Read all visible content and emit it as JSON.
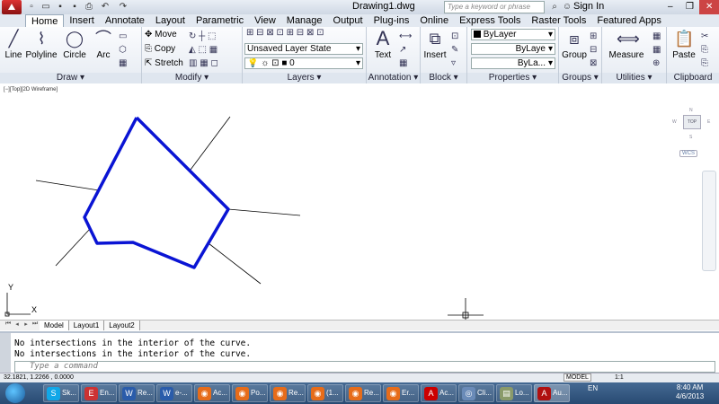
{
  "titlebar": {
    "doc_title": "Drawing1.dwg",
    "search_placeholder": "Type a keyword or phrase",
    "signin": "Sign In"
  },
  "tabs": [
    "Home",
    "Insert",
    "Annotate",
    "Layout",
    "Parametric",
    "View",
    "Manage",
    "Output",
    "Plug-ins",
    "Online",
    "Express Tools",
    "Raster Tools",
    "Featured Apps"
  ],
  "ribbon": {
    "draw": {
      "label": "Draw",
      "line": "Line",
      "polyline": "Polyline",
      "circle": "Circle",
      "arc": "Arc"
    },
    "modify": {
      "label": "Modify",
      "move": "Move",
      "copy": "Copy",
      "stretch": "Stretch"
    },
    "layers": {
      "label": "Layers",
      "layer_state": "Unsaved Layer State",
      "current_layer": "0"
    },
    "annotation": {
      "label": "Annotation",
      "text": "Text"
    },
    "block": {
      "label": "Block",
      "insert": "Insert"
    },
    "properties": {
      "label": "Properties",
      "color": "ByLayer",
      "linetype": "ByLaye",
      "lineweight": "ByLa..."
    },
    "groups": {
      "label": "Groups",
      "group": "Group"
    },
    "utilities": {
      "label": "Utilities",
      "measure": "Measure"
    },
    "clipboard": {
      "label": "Clipboard",
      "paste": "Paste"
    }
  },
  "viewport": {
    "label": "[−][Top][2D Wireframe]",
    "viewcube_top": "TOP",
    "n": "N",
    "s": "S",
    "w": "W",
    "e": "E",
    "wcs": "WCS",
    "axis_x": "X",
    "axis_y": "Y"
  },
  "layout_tabs": [
    "Model",
    "Layout1",
    "Layout2"
  ],
  "command": {
    "history": [
      "No intersections in the interior of the curve.",
      "No intersections in the interior of the curve."
    ],
    "placeholder": "Type a command"
  },
  "status": {
    "coords": "32.1821, 1.2266 , 0.0000",
    "model": "MODEL",
    "scale": "1:1"
  },
  "taskbar": {
    "items": [
      "Sk...",
      "En...",
      "Re...",
      "e-...",
      "Ac...",
      "Po...",
      "Re...",
      "(1...",
      "Re...",
      "Er...",
      "Ac...",
      "Cli...",
      "Lo...",
      "Au..."
    ],
    "lang": "EN",
    "time": "8:40 AM",
    "date": "4/6/2013"
  },
  "colors": {
    "polyline": "#0a14d4"
  }
}
